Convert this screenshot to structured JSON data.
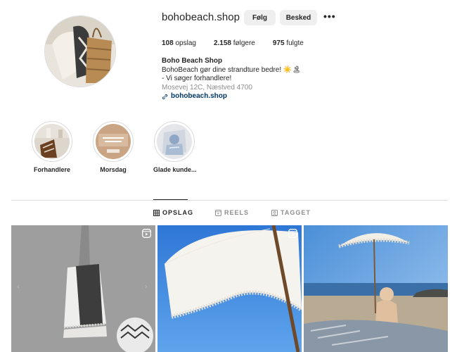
{
  "profile": {
    "username": "bohobeach.shop",
    "follow_label": "Følg",
    "message_label": "Besked",
    "more_label": "•••",
    "stats": {
      "posts_count": "108",
      "posts_label": "opslag",
      "followers_count": "2.158",
      "followers_label": "følgere",
      "following_count": "975",
      "following_label": "fulgte"
    },
    "bio": {
      "name": "Boho Beach Shop",
      "line1": "BohoBeach gør dine strandture bedre! ☀️🏝",
      "line2": "- Vi søger forhandlere!",
      "address": "Mosevej 12C, Næstved 4700",
      "link": "bohobeach.shop"
    }
  },
  "highlights": [
    {
      "label": "Forhandlere"
    },
    {
      "label": "Morsdag"
    },
    {
      "label": "Glade kunde..."
    }
  ],
  "tabs": {
    "posts": "OPSLAG",
    "reels": "REELS",
    "tagged": "TAGGET"
  },
  "colors": {
    "link": "#00376b",
    "button_bg": "#efefef",
    "border": "#dbdbdb"
  }
}
